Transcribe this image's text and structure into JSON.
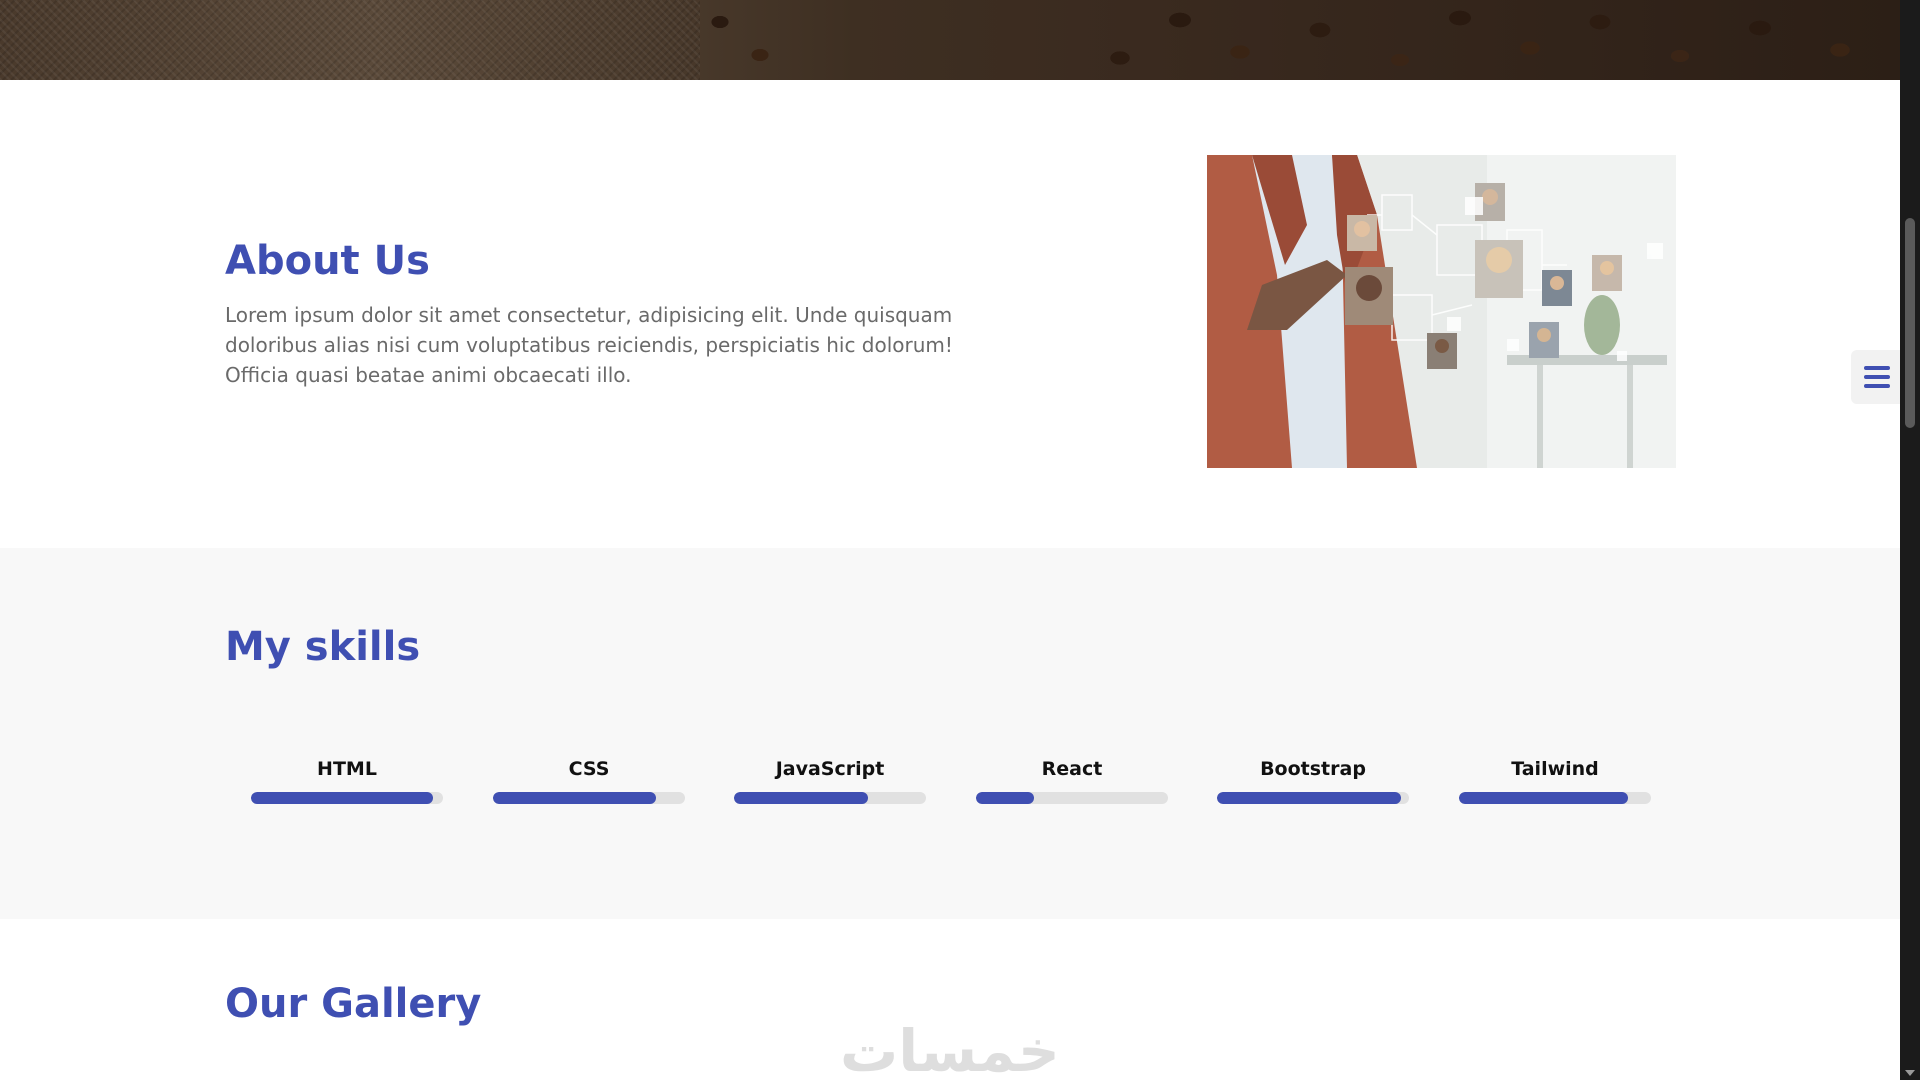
{
  "about": {
    "title": "About Us",
    "text": "Lorem ipsum dolor sit amet consectetur, adipisicing elit. Unde quisquam doloribus alias nisi cum voluptatibus reiciendis, perspiciatis hic dolorum! Officia quasi beatae animi obcaecati illo."
  },
  "skills": {
    "title": "My skills",
    "items": [
      {
        "name": "HTML",
        "percent": 95
      },
      {
        "name": "CSS",
        "percent": 85
      },
      {
        "name": "JavaScript",
        "percent": 70
      },
      {
        "name": "React",
        "percent": 30
      },
      {
        "name": "Bootstrap",
        "percent": 96
      },
      {
        "name": "Tailwind",
        "percent": 88
      }
    ]
  },
  "gallery": {
    "title": "Our Gallery"
  },
  "watermark": "خمسات",
  "icons": {
    "settings": "gear-icon",
    "menu": "hamburger-menu-icon"
  },
  "colors": {
    "accent": "#3f4fb2",
    "track": "#e1e1e1",
    "section_alt_bg": "#f8f8f8"
  }
}
